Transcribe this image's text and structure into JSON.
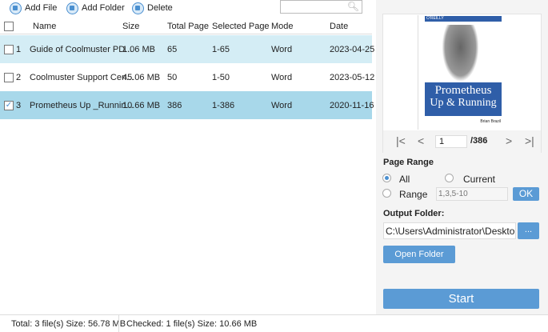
{
  "toolbar": {
    "add_file": "Add File",
    "add_folder": "Add Folder",
    "delete": "Delete",
    "search_placeholder": ""
  },
  "table": {
    "headers": [
      "Name",
      "Size",
      "Total Page",
      "Selected Page",
      "Mode",
      "Date"
    ],
    "rows": [
      {
        "index": "1",
        "name": "Guide of Coolmuster PD...",
        "size": "1.06 MB",
        "total": "65",
        "selected": "1-65",
        "mode": "Word",
        "date": "2023-04-25",
        "checked": false
      },
      {
        "index": "2",
        "name": "Coolmuster Support Cen...",
        "size": "45.06 MB",
        "total": "50",
        "selected": "1-50",
        "mode": "Word",
        "date": "2023-05-12",
        "checked": false
      },
      {
        "index": "3",
        "name": "Prometheus Up _Runnin...",
        "size": "10.66 MB",
        "total": "386",
        "selected": "1-386",
        "mode": "Word",
        "date": "2020-11-16",
        "checked": true
      }
    ]
  },
  "preview": {
    "publisher": "O'REILLY",
    "title1": "Prometheus",
    "title2": "Up & Running",
    "author": "Brian Brazil",
    "page": "1",
    "total": "/386"
  },
  "range": {
    "label": "Page Range",
    "all": "All",
    "current": "Current",
    "range": "Range",
    "range_value": "1,3,5-10",
    "ok": "OK"
  },
  "output": {
    "label": "Output Folder:",
    "path": "C:\\Users\\Administrator\\Desktop",
    "browse": "...",
    "open": "Open Folder"
  },
  "start": "Start",
  "status": {
    "total": "Total: 3 file(s) Size: 56.78 MB",
    "checked": "Checked: 1 file(s) Size: 10.66 MB"
  }
}
